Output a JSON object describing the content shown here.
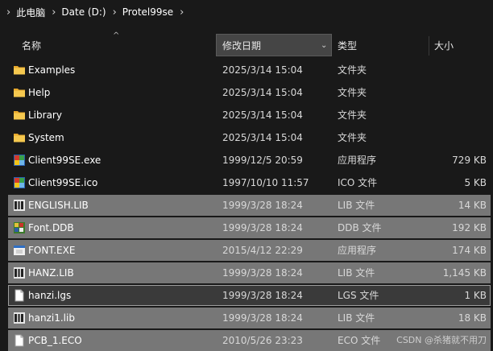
{
  "breadcrumb": [
    "此电脑",
    "Date (D:)",
    "Protel99se"
  ],
  "columns": {
    "name": "名称",
    "date": "修改日期",
    "type": "类型",
    "size": "大小"
  },
  "files": [
    {
      "name": "Examples",
      "date": "2025/3/14 15:04",
      "type": "文件夹",
      "size": "",
      "icon": "folder-icon"
    },
    {
      "name": "Help",
      "date": "2025/3/14 15:04",
      "type": "文件夹",
      "size": "",
      "icon": "folder-icon"
    },
    {
      "name": "Library",
      "date": "2025/3/14 15:04",
      "type": "文件夹",
      "size": "",
      "icon": "folder-icon"
    },
    {
      "name": "System",
      "date": "2025/3/14 15:04",
      "type": "文件夹",
      "size": "",
      "icon": "folder-icon"
    },
    {
      "name": "Client99SE.exe",
      "date": "1999/12/5 20:59",
      "type": "应用程序",
      "size": "729 KB",
      "icon": "app-icon"
    },
    {
      "name": "Client99SE.ico",
      "date": "1997/10/10 11:57",
      "type": "ICO 文件",
      "size": "5 KB",
      "icon": "app-icon"
    },
    {
      "name": "ENGLISH.LIB",
      "date": "1999/3/28 18:24",
      "type": "LIB 文件",
      "size": "14 KB",
      "icon": "lib-file-icon"
    },
    {
      "name": "Font.DDB",
      "date": "1999/3/28 18:24",
      "type": "DDB 文件",
      "size": "192 KB",
      "icon": "ddb-file-icon"
    },
    {
      "name": "FONT.EXE",
      "date": "2015/4/12 22:29",
      "type": "应用程序",
      "size": "174 KB",
      "icon": "exe-window-icon"
    },
    {
      "name": "HANZ.LIB",
      "date": "1999/3/28 18:24",
      "type": "LIB 文件",
      "size": "1,145 KB",
      "icon": "lib-file-icon"
    },
    {
      "name": "hanzi.lgs",
      "date": "1999/3/28 18:24",
      "type": "LGS 文件",
      "size": "1 KB",
      "icon": "blank-file-icon"
    },
    {
      "name": "hanzi1.lib",
      "date": "1999/3/28 18:24",
      "type": "LIB 文件",
      "size": "18 KB",
      "icon": "lib-file-icon"
    },
    {
      "name": "PCB_1.ECO",
      "date": "2010/5/26 23:23",
      "type": "ECO 文件",
      "size": "",
      "icon": "blank-file-icon"
    }
  ],
  "watermark": "CSDN @杀猪就不用刀",
  "colors": {
    "background": "#191919",
    "selected": "#777777",
    "focused_border": "#9e9e9e",
    "folder": "#f3c14b"
  }
}
